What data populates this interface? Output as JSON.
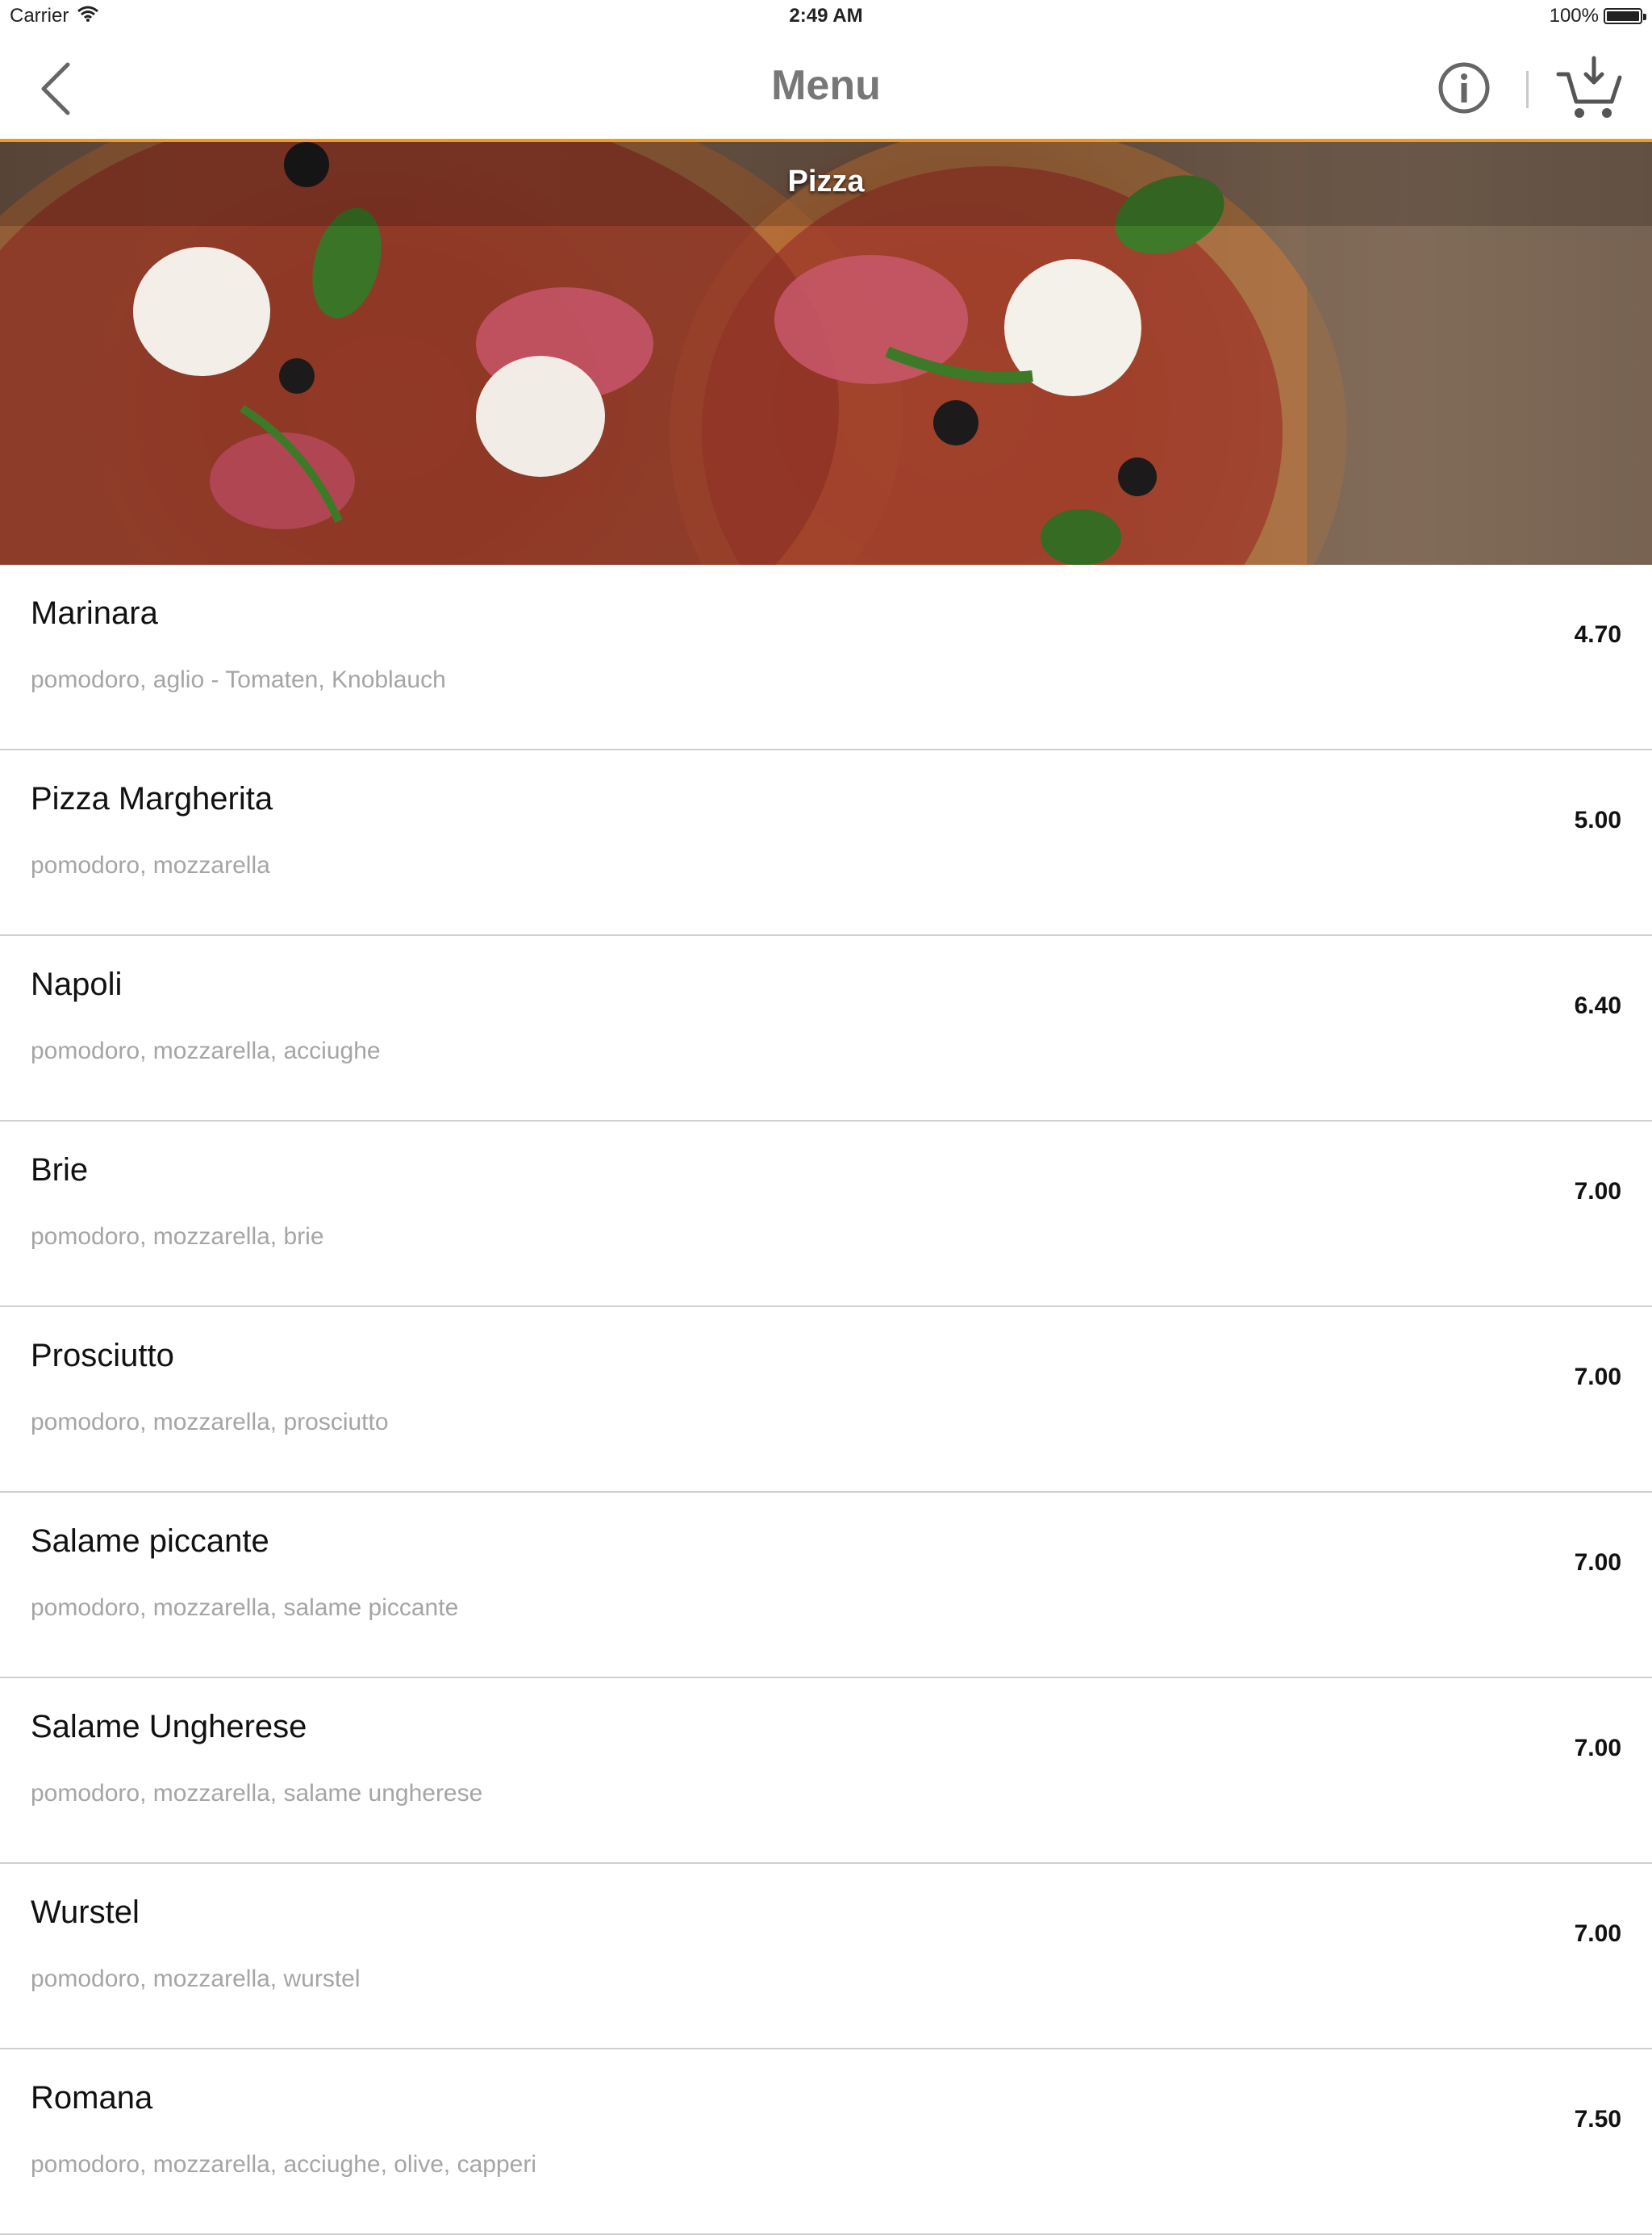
{
  "status_bar": {
    "carrier": "Carrier",
    "time": "2:49 AM",
    "battery": "100%"
  },
  "nav": {
    "title": "Menu",
    "back_icon": "chevron-left-icon",
    "info_icon": "info-icon",
    "cart_icon": "cart-icon"
  },
  "colors": {
    "accent": "#f29a1f",
    "title_gray": "#777777",
    "desc_gray": "#a5a5a5"
  },
  "category": {
    "title": "Pizza"
  },
  "items": [
    {
      "name": "Marinara",
      "desc": "pomodoro, aglio - Tomaten, Knoblauch",
      "price": "4.70"
    },
    {
      "name": "Pizza Margherita",
      "desc": "pomodoro, mozzarella",
      "price": "5.00"
    },
    {
      "name": "Napoli",
      "desc": "pomodoro, mozzarella, acciughe",
      "price": "6.40"
    },
    {
      "name": "Brie",
      "desc": "pomodoro, mozzarella, brie",
      "price": "7.00"
    },
    {
      "name": "Prosciutto",
      "desc": "pomodoro, mozzarella, prosciutto",
      "price": "7.00"
    },
    {
      "name": "Salame piccante",
      "desc": "pomodoro, mozzarella, salame piccante",
      "price": "7.00"
    },
    {
      "name": "Salame Ungherese",
      "desc": "pomodoro, mozzarella, salame ungherese",
      "price": "7.00"
    },
    {
      "name": "Wurstel",
      "desc": "pomodoro, mozzarella, wurstel",
      "price": "7.00"
    },
    {
      "name": "Romana",
      "desc": "pomodoro, mozzarella, acciughe, olive, capperi",
      "price": "7.50"
    }
  ]
}
